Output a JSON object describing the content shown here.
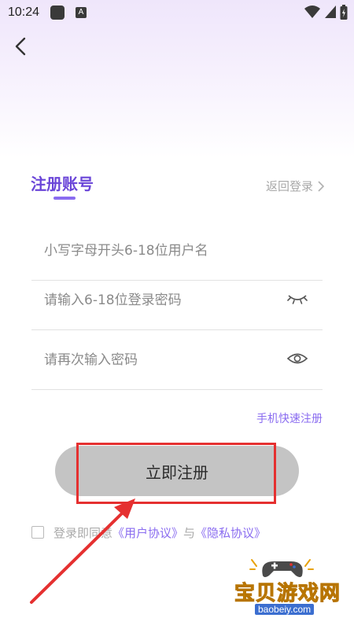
{
  "status_bar": {
    "time": "10:24",
    "notif_letter": "A"
  },
  "header": {
    "title": "注册账号",
    "back_login_label": "返回登录"
  },
  "form": {
    "username_placeholder": "小写字母开头6-18位用户名",
    "password_placeholder": "请输入6-18位登录密码",
    "confirm_password_placeholder": "请再次输入密码",
    "phone_register_link": "手机快速注册",
    "submit_label": "立即注册"
  },
  "agreement": {
    "prefix": "登录即同意",
    "user_agreement": "《用户协议》",
    "conjunction": "与",
    "privacy_policy": "《隐私协议》"
  },
  "watermark": {
    "title": "宝贝游戏网",
    "url": "baobeiy.com"
  },
  "colors": {
    "accent": "#8a6cf0",
    "title": "#6a45d8",
    "button": "#c4c4c4",
    "annotation_red": "#e53030"
  },
  "icons": {
    "back": "chevron-left-icon",
    "password_visibility": "eye-closed-icon",
    "confirm_visibility": "eye-open-icon",
    "wifi": "wifi-icon",
    "battery": "battery-icon"
  }
}
